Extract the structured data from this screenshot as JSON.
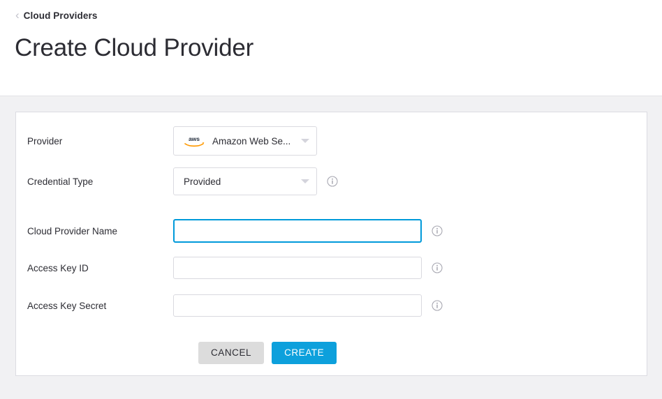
{
  "header": {
    "breadcrumb": {
      "icon": "chevron-left-icon",
      "label": "Cloud Providers"
    },
    "title": "Create Cloud Provider"
  },
  "form": {
    "fields": [
      {
        "id": "provider",
        "label": "Provider",
        "control": "select",
        "value": "Amazon Web Se...",
        "logo": "aws-logo",
        "caret": "chevron-down-icon",
        "info": false
      },
      {
        "id": "credential-type",
        "label": "Credential Type",
        "control": "select",
        "value": "Provided",
        "caret": "chevron-down-icon",
        "info": true,
        "info_icon": "info-circle-icon"
      },
      {
        "id": "cloud-provider-name",
        "label": "Cloud Provider Name",
        "control": "text",
        "value": "",
        "placeholder": "",
        "focused": true,
        "info": true,
        "info_icon": "info-circle-icon"
      },
      {
        "id": "access-key-id",
        "label": "Access Key ID",
        "control": "text",
        "value": "",
        "placeholder": "",
        "focused": false,
        "info": true,
        "info_icon": "info-circle-icon"
      },
      {
        "id": "access-key-secret",
        "label": "Access Key Secret",
        "control": "text",
        "value": "",
        "placeholder": "",
        "focused": false,
        "info": true,
        "info_icon": "info-circle-icon"
      }
    ],
    "buttons": {
      "cancel": "CANCEL",
      "create": "CREATE"
    }
  },
  "colors": {
    "page_background": "#f1f1f3",
    "card_background": "#ffffff",
    "accent_blue": "#0da0dc",
    "focus_border": "#009ada",
    "cancel_gray": "#dcdcdc",
    "text_primary": "#2c2c33",
    "border_gray": "#dcdce2",
    "aws_orange": "#ff9900",
    "aws_navy": "#252f3e"
  }
}
